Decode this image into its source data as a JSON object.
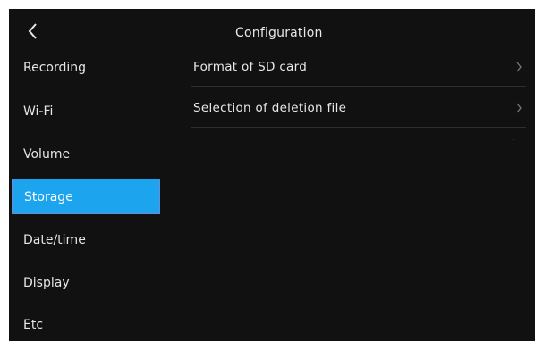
{
  "header": {
    "title": "Configuration",
    "back_icon": "chevron-left-icon"
  },
  "sidebar": {
    "items": [
      {
        "label": "Recording",
        "active": false
      },
      {
        "label": "Wi-Fi",
        "active": false
      },
      {
        "label": "Volume",
        "active": false
      },
      {
        "label": "Storage",
        "active": true
      },
      {
        "label": "Date/time",
        "active": false
      },
      {
        "label": "Display",
        "active": false
      },
      {
        "label": "Etc",
        "active": false
      }
    ]
  },
  "main": {
    "rows": [
      {
        "label": "Format of SD card",
        "icon": "chevron-right-icon"
      },
      {
        "label": "Selection of deletion file",
        "icon": "chevron-right-icon"
      }
    ]
  },
  "colors": {
    "background": "#111111",
    "active_item": "#1ca5ee",
    "active_border": "#6a8dd8",
    "text": "#e8e8e8"
  }
}
